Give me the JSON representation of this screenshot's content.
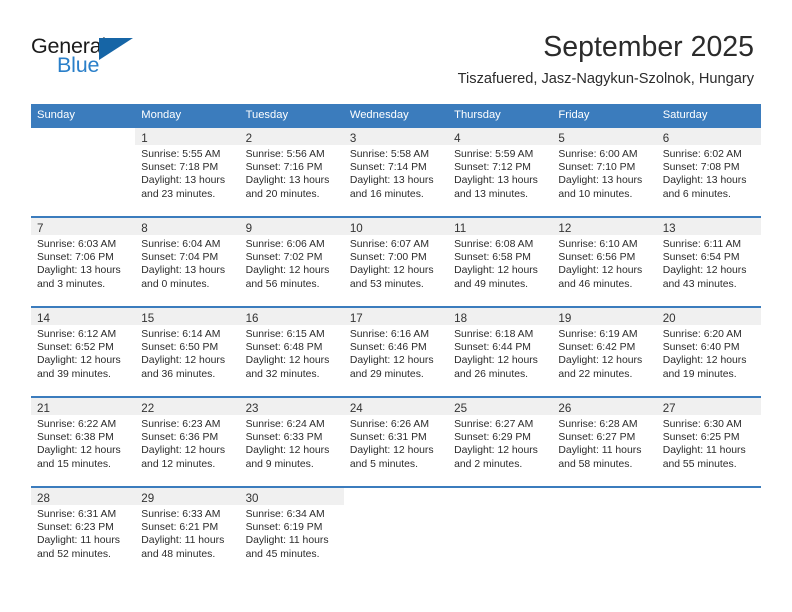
{
  "brand": {
    "name_part1": "General",
    "name_part2": "Blue",
    "flag_icon": "blue-triangle-flag-icon",
    "accent_color": "#2a7fc9",
    "flag_color": "#1665a6"
  },
  "header": {
    "month_title": "September 2025",
    "location": "Tiszafuered, Jasz-Nagykun-Szolnok, Hungary"
  },
  "calendar": {
    "header_color": "#3b7cbd",
    "daynum_band_color": "#f0f0f0",
    "weekday_headers": [
      "Sunday",
      "Monday",
      "Tuesday",
      "Wednesday",
      "Thursday",
      "Friday",
      "Saturday"
    ],
    "weeks": [
      [
        {
          "day": "",
          "lines": []
        },
        {
          "day": "1",
          "lines": [
            "Sunrise: 5:55 AM",
            "Sunset: 7:18 PM",
            "Daylight: 13 hours",
            "and 23 minutes."
          ]
        },
        {
          "day": "2",
          "lines": [
            "Sunrise: 5:56 AM",
            "Sunset: 7:16 PM",
            "Daylight: 13 hours",
            "and 20 minutes."
          ]
        },
        {
          "day": "3",
          "lines": [
            "Sunrise: 5:58 AM",
            "Sunset: 7:14 PM",
            "Daylight: 13 hours",
            "and 16 minutes."
          ]
        },
        {
          "day": "4",
          "lines": [
            "Sunrise: 5:59 AM",
            "Sunset: 7:12 PM",
            "Daylight: 13 hours",
            "and 13 minutes."
          ]
        },
        {
          "day": "5",
          "lines": [
            "Sunrise: 6:00 AM",
            "Sunset: 7:10 PM",
            "Daylight: 13 hours",
            "and 10 minutes."
          ]
        },
        {
          "day": "6",
          "lines": [
            "Sunrise: 6:02 AM",
            "Sunset: 7:08 PM",
            "Daylight: 13 hours",
            "and 6 minutes."
          ]
        }
      ],
      [
        {
          "day": "7",
          "lines": [
            "Sunrise: 6:03 AM",
            "Sunset: 7:06 PM",
            "Daylight: 13 hours",
            "and 3 minutes."
          ]
        },
        {
          "day": "8",
          "lines": [
            "Sunrise: 6:04 AM",
            "Sunset: 7:04 PM",
            "Daylight: 13 hours",
            "and 0 minutes."
          ]
        },
        {
          "day": "9",
          "lines": [
            "Sunrise: 6:06 AM",
            "Sunset: 7:02 PM",
            "Daylight: 12 hours",
            "and 56 minutes."
          ]
        },
        {
          "day": "10",
          "lines": [
            "Sunrise: 6:07 AM",
            "Sunset: 7:00 PM",
            "Daylight: 12 hours",
            "and 53 minutes."
          ]
        },
        {
          "day": "11",
          "lines": [
            "Sunrise: 6:08 AM",
            "Sunset: 6:58 PM",
            "Daylight: 12 hours",
            "and 49 minutes."
          ]
        },
        {
          "day": "12",
          "lines": [
            "Sunrise: 6:10 AM",
            "Sunset: 6:56 PM",
            "Daylight: 12 hours",
            "and 46 minutes."
          ]
        },
        {
          "day": "13",
          "lines": [
            "Sunrise: 6:11 AM",
            "Sunset: 6:54 PM",
            "Daylight: 12 hours",
            "and 43 minutes."
          ]
        }
      ],
      [
        {
          "day": "14",
          "lines": [
            "Sunrise: 6:12 AM",
            "Sunset: 6:52 PM",
            "Daylight: 12 hours",
            "and 39 minutes."
          ]
        },
        {
          "day": "15",
          "lines": [
            "Sunrise: 6:14 AM",
            "Sunset: 6:50 PM",
            "Daylight: 12 hours",
            "and 36 minutes."
          ]
        },
        {
          "day": "16",
          "lines": [
            "Sunrise: 6:15 AM",
            "Sunset: 6:48 PM",
            "Daylight: 12 hours",
            "and 32 minutes."
          ]
        },
        {
          "day": "17",
          "lines": [
            "Sunrise: 6:16 AM",
            "Sunset: 6:46 PM",
            "Daylight: 12 hours",
            "and 29 minutes."
          ]
        },
        {
          "day": "18",
          "lines": [
            "Sunrise: 6:18 AM",
            "Sunset: 6:44 PM",
            "Daylight: 12 hours",
            "and 26 minutes."
          ]
        },
        {
          "day": "19",
          "lines": [
            "Sunrise: 6:19 AM",
            "Sunset: 6:42 PM",
            "Daylight: 12 hours",
            "and 22 minutes."
          ]
        },
        {
          "day": "20",
          "lines": [
            "Sunrise: 6:20 AM",
            "Sunset: 6:40 PM",
            "Daylight: 12 hours",
            "and 19 minutes."
          ]
        }
      ],
      [
        {
          "day": "21",
          "lines": [
            "Sunrise: 6:22 AM",
            "Sunset: 6:38 PM",
            "Daylight: 12 hours",
            "and 15 minutes."
          ]
        },
        {
          "day": "22",
          "lines": [
            "Sunrise: 6:23 AM",
            "Sunset: 6:36 PM",
            "Daylight: 12 hours",
            "and 12 minutes."
          ]
        },
        {
          "day": "23",
          "lines": [
            "Sunrise: 6:24 AM",
            "Sunset: 6:33 PM",
            "Daylight: 12 hours",
            "and 9 minutes."
          ]
        },
        {
          "day": "24",
          "lines": [
            "Sunrise: 6:26 AM",
            "Sunset: 6:31 PM",
            "Daylight: 12 hours",
            "and 5 minutes."
          ]
        },
        {
          "day": "25",
          "lines": [
            "Sunrise: 6:27 AM",
            "Sunset: 6:29 PM",
            "Daylight: 12 hours",
            "and 2 minutes."
          ]
        },
        {
          "day": "26",
          "lines": [
            "Sunrise: 6:28 AM",
            "Sunset: 6:27 PM",
            "Daylight: 11 hours",
            "and 58 minutes."
          ]
        },
        {
          "day": "27",
          "lines": [
            "Sunrise: 6:30 AM",
            "Sunset: 6:25 PM",
            "Daylight: 11 hours",
            "and 55 minutes."
          ]
        }
      ],
      [
        {
          "day": "28",
          "lines": [
            "Sunrise: 6:31 AM",
            "Sunset: 6:23 PM",
            "Daylight: 11 hours",
            "and 52 minutes."
          ]
        },
        {
          "day": "29",
          "lines": [
            "Sunrise: 6:33 AM",
            "Sunset: 6:21 PM",
            "Daylight: 11 hours",
            "and 48 minutes."
          ]
        },
        {
          "day": "30",
          "lines": [
            "Sunrise: 6:34 AM",
            "Sunset: 6:19 PM",
            "Daylight: 11 hours",
            "and 45 minutes."
          ]
        },
        {
          "day": "",
          "lines": []
        },
        {
          "day": "",
          "lines": []
        },
        {
          "day": "",
          "lines": []
        },
        {
          "day": "",
          "lines": []
        }
      ]
    ]
  }
}
